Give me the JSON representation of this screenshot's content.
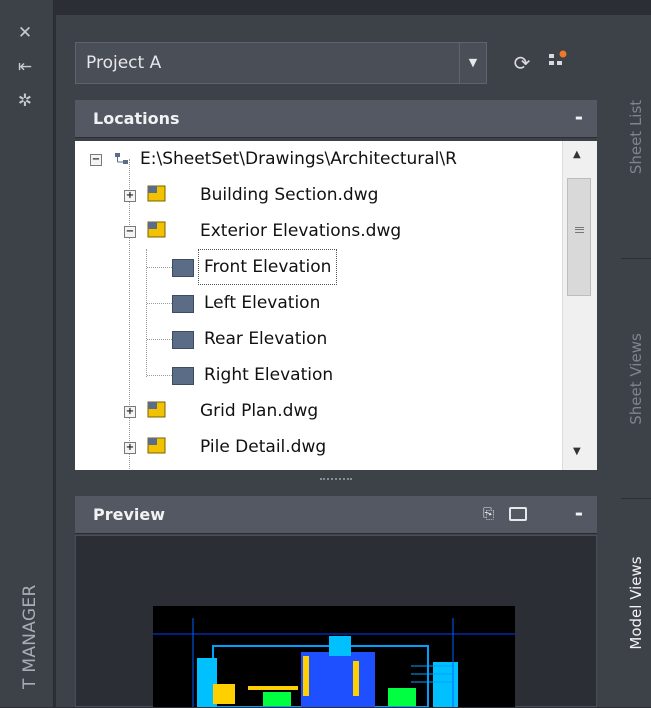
{
  "window": {
    "title": "SHEET SET MANAGER",
    "title_visible": "T MANAGER"
  },
  "project_selector": {
    "value": "Project A"
  },
  "locations": {
    "header": "Locations",
    "collapse_label": "-",
    "tree": [
      {
        "level": 0,
        "label": "E:\\SheetSet\\Drawings\\Architectural\\R",
        "kind": "folder",
        "expander": "−"
      },
      {
        "level": 1,
        "label": "Building Section.dwg",
        "kind": "file",
        "expander": "+"
      },
      {
        "level": 1,
        "label": "Exterior Elevations.dwg",
        "kind": "file",
        "expander": "−"
      },
      {
        "level": 2,
        "label": "Front Elevation",
        "kind": "view",
        "selected": true
      },
      {
        "level": 2,
        "label": "Left Elevation",
        "kind": "view"
      },
      {
        "level": 2,
        "label": "Rear Elevation",
        "kind": "view"
      },
      {
        "level": 2,
        "label": "Right Elevation",
        "kind": "view"
      },
      {
        "level": 1,
        "label": "Grid Plan.dwg",
        "kind": "file",
        "expander": "+"
      },
      {
        "level": 1,
        "label": "Pile Detail.dwg",
        "kind": "file",
        "expander": "+"
      }
    ]
  },
  "preview": {
    "header": "Preview",
    "collapse_label": "-"
  },
  "side_tabs": [
    {
      "label": "Sheet List",
      "active": false
    },
    {
      "label": "Sheet Views",
      "active": false
    },
    {
      "label": "Model Views",
      "active": true
    }
  ],
  "colors": {
    "panel": "#3d4148",
    "header": "#535862",
    "tree_bg": "#ffffff",
    "folder_yellow": "#f2c200"
  }
}
